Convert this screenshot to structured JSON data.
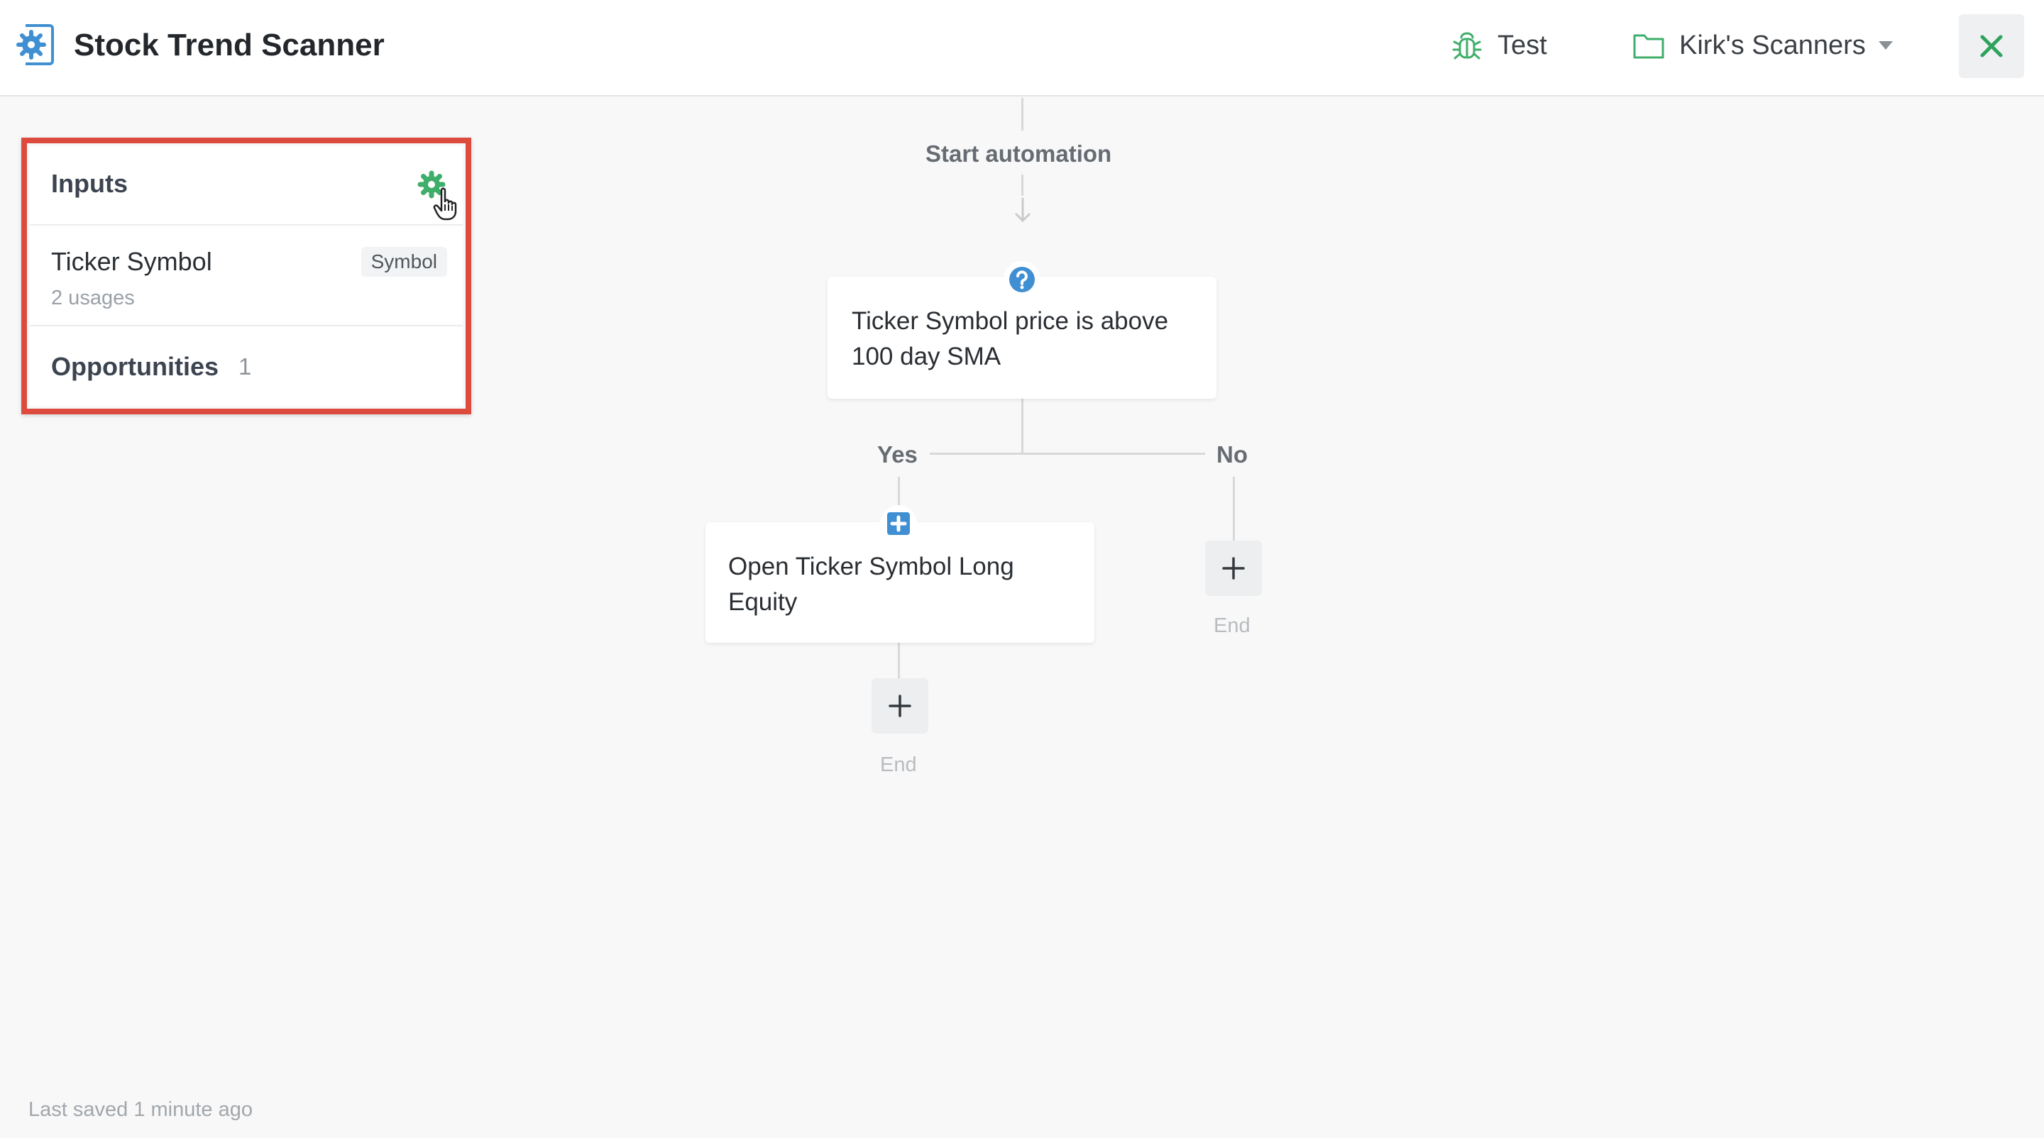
{
  "header": {
    "app_icon": "gear-document-icon",
    "title": "Stock Trend Scanner",
    "test": {
      "icon": "bug-icon",
      "label": "Test"
    },
    "folder": {
      "icon": "folder-icon",
      "label": "Kirk's Scanners",
      "dropdown_icon": "caret-down-icon"
    },
    "close_icon": "close-icon"
  },
  "inputs_panel": {
    "title": "Inputs",
    "settings_icon": "gear-icon",
    "items": [
      {
        "name": "Ticker Symbol",
        "usages": "2 usages",
        "type": "Symbol"
      }
    ],
    "opportunities": {
      "label": "Opportunities",
      "count": "1"
    }
  },
  "flow": {
    "start_label": "Start automation",
    "condition": {
      "icon": "question-icon",
      "text": "Ticker Symbol price is above 100 day SMA"
    },
    "branches": {
      "yes": "Yes",
      "no": "No"
    },
    "action": {
      "icon": "plus-square-icon",
      "text": "Open Ticker Symbol Long Equity"
    },
    "end_yes": "End",
    "end_no": "End"
  },
  "footer": {
    "last_saved": "Last saved 1 minute ago"
  },
  "colors": {
    "accent_blue": "#3f8fd2",
    "accent_green": "#3fae6a",
    "highlight_red": "#dd4b3f"
  }
}
